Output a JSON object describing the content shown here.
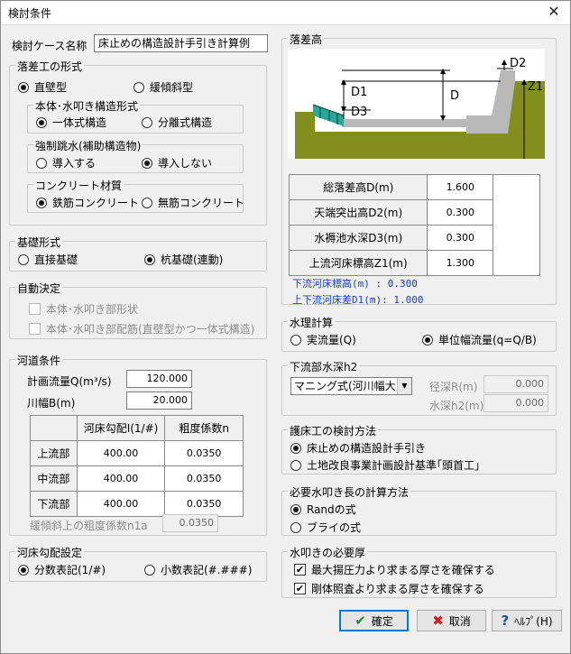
{
  "window": {
    "title": "検討条件",
    "close_glyph": "✕"
  },
  "case": {
    "label": "検討ケース名称",
    "value": "床止めの構造設計手引き計算例"
  },
  "drop_form": {
    "label": "落差工の形式",
    "opt_vertical": "直壁型",
    "opt_slope": "緩傾斜型",
    "body": {
      "label": "本体･水叩き構造形式",
      "opt_integrated": "一体式構造",
      "opt_separated": "分離式構造"
    },
    "jump": {
      "label": "強制跳水(補助構造物)",
      "opt_install": "導入する",
      "opt_none": "導入しない"
    },
    "concrete": {
      "label": "コンクリート材質",
      "opt_rc": "鉄筋コンクリート",
      "opt_plain": "無筋コンクリート"
    }
  },
  "foundation": {
    "label": "基礎形式",
    "opt_direct": "直接基礎",
    "opt_pile": "杭基礎(連動)"
  },
  "auto": {
    "label": "自動決定",
    "chk_shape": "本体･水叩き部形状",
    "chk_rebar": "本体･水叩き部配筋(直壁型かつ一体式構造)"
  },
  "channel": {
    "label": "河道条件",
    "flow_label": "計画流量Q(m³/s)",
    "flow_value": "120.000",
    "width_label": "川幅B(m)",
    "width_value": "20.000",
    "table_headers": [
      "",
      "河床勾配I(1/#)",
      "粗度係数n"
    ],
    "rows": [
      {
        "name": "上流部",
        "slope": "400.00",
        "n": "0.0350"
      },
      {
        "name": "中流部",
        "slope": "400.00",
        "n": "0.0350"
      },
      {
        "name": "下流部",
        "slope": "400.00",
        "n": "0.0350"
      }
    ],
    "gentle_label": "緩傾斜上の粗度係数n1a",
    "gentle_value": "0.0350"
  },
  "slope_notation": {
    "label": "河床勾配設定",
    "opt_fraction": "分数表記(1/#)",
    "opt_decimal": "小数表記(#.###)"
  },
  "drop_height": {
    "label": "落差高",
    "fig": {
      "d1": "D1",
      "d2": "D2",
      "d3": "D3",
      "d": "D",
      "z1": "Z1"
    },
    "rows": [
      {
        "label": "総落差高D(m)",
        "value": "1.600"
      },
      {
        "label": "天端突出高D2(m)",
        "value": "0.300"
      },
      {
        "label": "水褥池水深D3(m)",
        "value": "0.300"
      },
      {
        "label": "上流河床標高Z1(m)",
        "value": "1.300"
      }
    ],
    "info1": "下流河床標高(m)  :  0.300",
    "info2": "上下流河床差D1(m):  1.000"
  },
  "hydraulic": {
    "label": "水理計算",
    "opt_actual": "実流量(Q)",
    "opt_unit": "単位幅流量(q=Q/B)"
  },
  "downstream": {
    "label": "下流部水深h2",
    "select_value": "マニング式(河川幅大)",
    "radius_label": "径深R(m)",
    "radius_value": "0.000",
    "depth_label": "水深h2(m)",
    "depth_value": "0.000"
  },
  "bed_method": {
    "label": "護床工の検討方法",
    "opt_manual": "床止めの構造設計手引き",
    "opt_standard": "土地改良事業計画設計基準｢頭首工｣"
  },
  "apron_length": {
    "label": "必要水叩き長の計算方法",
    "opt_rand": "Randの式",
    "opt_bligh": "ブライの式"
  },
  "apron_thickness": {
    "label": "水叩きの必要厚",
    "chk_uplift": "最大揚圧力より求まる厚さを確保する",
    "chk_rigid": "剛体照査より求まる厚さを確保する"
  },
  "buttons": {
    "ok": "確定",
    "cancel": "取消",
    "help": "ﾍﾙﾌﾟ(H)"
  }
}
